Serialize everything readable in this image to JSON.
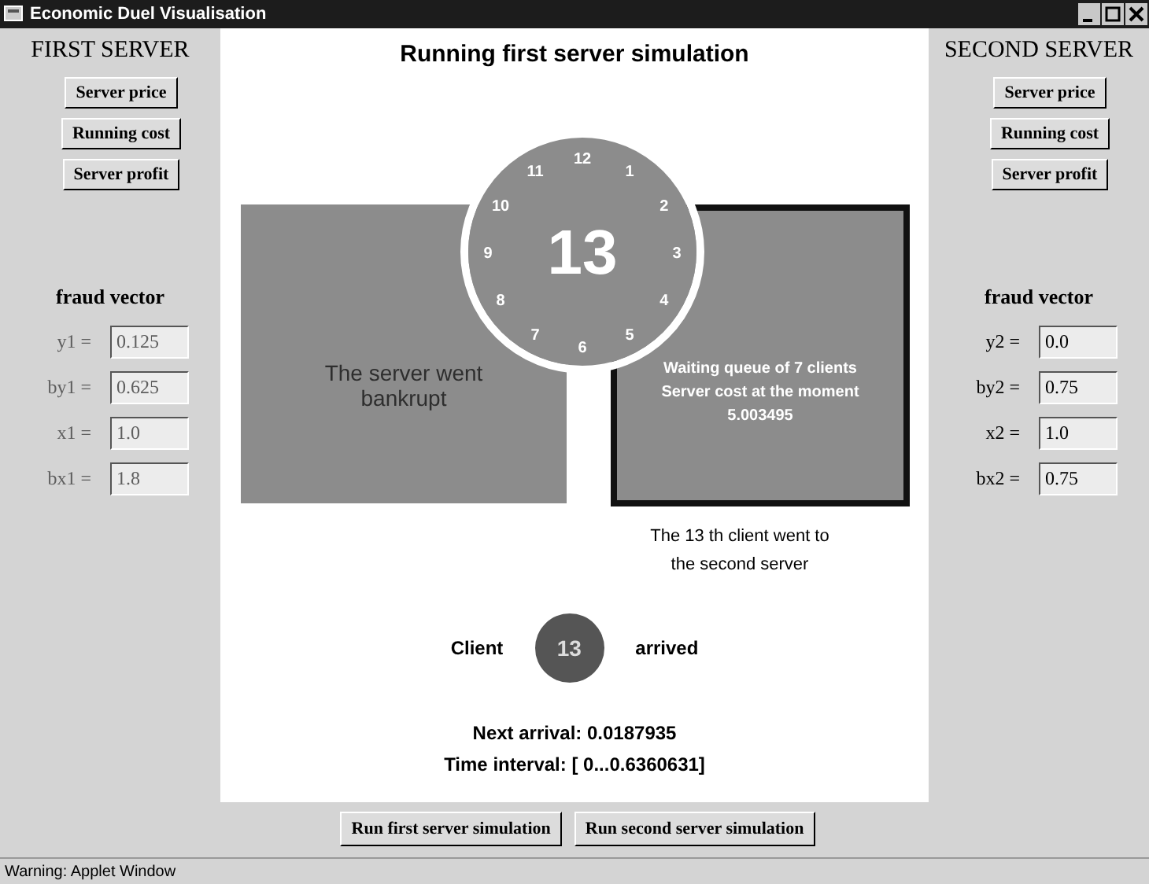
{
  "window": {
    "title": "Economic Duel Visualisation"
  },
  "servers": [
    {
      "heading": "FIRST SERVER",
      "disabled": true,
      "buttons": [
        "Server price",
        "Running cost",
        "Server profit"
      ],
      "fraud_title": "fraud vector",
      "fields": [
        {
          "label": "y1 =",
          "value": "0.125"
        },
        {
          "label": "by1 =",
          "value": "0.625"
        },
        {
          "label": "x1 =",
          "value": "1.0"
        },
        {
          "label": "bx1 =",
          "value": "1.8"
        }
      ]
    },
    {
      "heading": "SECOND SERVER",
      "disabled": false,
      "buttons": [
        "Server price",
        "Running cost",
        "Server profit"
      ],
      "fraud_title": "fraud vector",
      "fields": [
        {
          "label": "y2 =",
          "value": "0.0"
        },
        {
          "label": "by2 =",
          "value": "0.75"
        },
        {
          "label": "x2 =",
          "value": "1.0"
        },
        {
          "label": "bx2 =",
          "value": "0.75"
        }
      ]
    }
  ],
  "simulation": {
    "title": "Running first server simulation",
    "boxes": [
      {
        "active": false,
        "lines": [
          "The server went",
          "bankrupt"
        ]
      },
      {
        "active": true,
        "lines": [
          "Waiting queue of 7 clients",
          "Server cost at the moment",
          "5.003495"
        ]
      }
    ],
    "clock": {
      "dial": [
        "12",
        "1",
        "2",
        "3",
        "4",
        "5",
        "6",
        "7",
        "8",
        "9",
        "10",
        "11"
      ],
      "value": "13"
    },
    "message": [
      "The 13 th client went to",
      "the second server"
    ],
    "client": {
      "before": "Client",
      "number": "13",
      "after": "arrived"
    },
    "next_arrival": "Next arrival: 0.0187935",
    "time_interval": "Time interval: [ 0...0.6360631]"
  },
  "bottom_buttons": [
    "Run first server simulation",
    "Run second server simulation"
  ],
  "status_bar": "Warning: Applet Window"
}
